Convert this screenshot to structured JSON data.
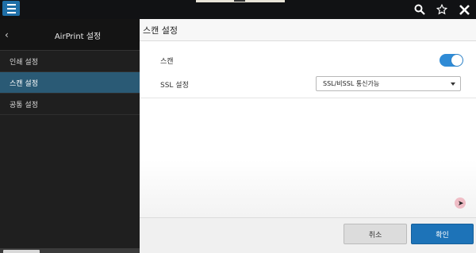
{
  "topbar": {
    "menu_icon": "hamburger-menu-icon",
    "icons": [
      "search-icon",
      "star-icon",
      "close-icon"
    ]
  },
  "sidebar": {
    "back_icon": "chevron-left-icon",
    "back_glyph": "‹",
    "title": "AirPrint 설정",
    "items": [
      {
        "label": "인쇄 설정",
        "active": false
      },
      {
        "label": "스캔 설정",
        "active": true
      },
      {
        "label": "공통 설정",
        "active": false
      }
    ]
  },
  "main": {
    "title": "스캔 설정",
    "rows": [
      {
        "label": "스캔",
        "control": "toggle",
        "value": "on"
      },
      {
        "label": "SSL 설정",
        "control": "select",
        "value": "SSL/비SSL 통신가능"
      }
    ]
  },
  "footer": {
    "cancel_label": "취소",
    "ok_label": "확인"
  },
  "colors": {
    "accent": "#1d73b8",
    "active_item": "#2a5a75",
    "toggle_on": "#2f8bd6"
  }
}
